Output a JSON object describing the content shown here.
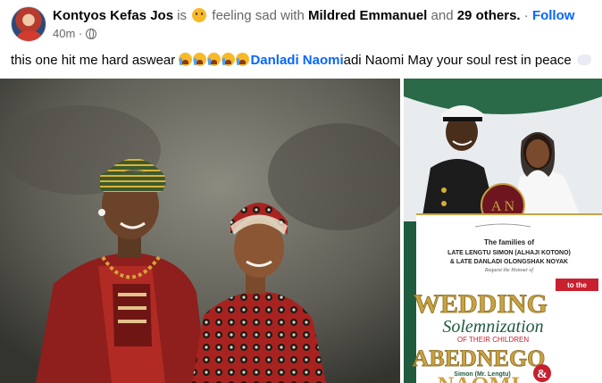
{
  "post": {
    "author": "Kontyos Kefas Jos",
    "is_word": "is",
    "feeling": "feeling sad with",
    "tagged": "Mildred Emmanuel",
    "and_word": "and",
    "others": "29 others",
    "separator": ".",
    "follow_label": "Follow",
    "time": "40m",
    "dot": "·",
    "caption_start": "this one hit me hard aswear",
    "mention": "Danladi Naomi",
    "caption_end": "adi Naomi May your soul rest in peace"
  },
  "invitation": {
    "families_line": "The families of",
    "family1": "LATE LENGTU SIMON (ALHAJI KOTONO)",
    "family2": "& LATE DANLADI OLONGSHAK NOYAK",
    "request": "Request the Honour of",
    "to_the": "to the",
    "wedding": "WEDDING",
    "solemnization": "Solemnization",
    "of_children": "OF THEIR CHILDREN",
    "groom": "ABEDNEGO",
    "groom_sub": "Simon (Mr. Lengtu)",
    "amp": "&",
    "monogram": "A N",
    "bride_partial": "NAOMI"
  },
  "colors": {
    "link": "#0866ff",
    "muted": "#65676b",
    "invite_green": "#1f5b3e",
    "invite_red": "#c8202f",
    "gold": "#c9a243"
  }
}
